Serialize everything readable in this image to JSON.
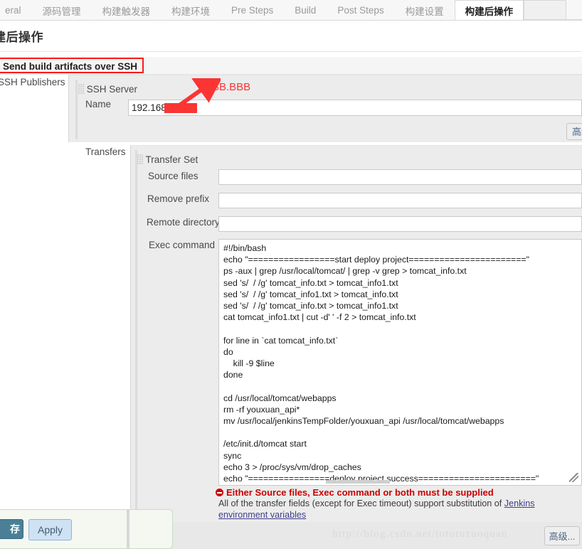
{
  "tabs": [
    {
      "label": "eral",
      "active": false
    },
    {
      "label": "源码管理",
      "active": false
    },
    {
      "label": "构建触发器",
      "active": false
    },
    {
      "label": "构建环境",
      "active": false
    },
    {
      "label": "Pre Steps",
      "active": false
    },
    {
      "label": "Build",
      "active": false
    },
    {
      "label": "Post Steps",
      "active": false
    },
    {
      "label": "构建设置",
      "active": false
    },
    {
      "label": "构建后操作",
      "active": true
    }
  ],
  "page": {
    "heading": "建后操作",
    "plugin_title": "Send build artifacts over SSH"
  },
  "ssh": {
    "publishers_label": "SSH Publishers",
    "server_label": "SSH Server",
    "name_label": "Name",
    "name_value": "192.168.",
    "advanced_top_label": "高级..."
  },
  "transfers": {
    "label": "Transfers",
    "set_label": "Transfer Set",
    "fields": [
      {
        "label": "Source files",
        "value": ""
      },
      {
        "label": "Remove prefix",
        "value": ""
      },
      {
        "label": "Remote directory",
        "value": ""
      }
    ],
    "exec_label": "Exec command",
    "exec_value": "#!/bin/bash\necho \"=================start deploy project=======================\"\nps -aux | grep /usr/local/tomcat/ | grep -v grep > tomcat_info.txt\nsed 's/  / /g' tomcat_info.txt > tomcat_info1.txt\nsed 's/  / /g' tomcat_info1.txt > tomcat_info.txt\nsed 's/  / /g' tomcat_info.txt > tomcat_info1.txt\ncat tomcat_info1.txt | cut -d' ' -f 2 > tomcat_info.txt\n\nfor line in `cat tomcat_info.txt`\ndo\n    kill -9 $line\ndone\n\ncd /usr/local/tomcat/webapps\nrm -rf youxuan_api*\nmv /usr/local/jenkinsTempFolder/youxuan_api /usr/local/tomcat/webapps\n\n/etc/init.d/tomcat start\nsync\necho 3 > /proc/sys/vm/drop_caches\necho \"================deploy project success=======================\""
  },
  "messages": {
    "error": "Either Source files, Exec command or both must be supplied",
    "help_prefix": "All of the transfer fields (except for Exec timeout) support substitution of ",
    "help_link": "Jenkins environment variables"
  },
  "buttons": {
    "save": "存",
    "apply": "Apply",
    "advanced_bottom": "高级..."
  },
  "annotations": {
    "bbbb": "BB.BBB"
  },
  "watermark": "http://blog.csdn.net/tototuzuoquan",
  "colors": {
    "accent_red": "#fb3434",
    "error_red": "#cc0000",
    "save_blue": "#4a7f96",
    "apply_blue": "#cfe2f3"
  }
}
